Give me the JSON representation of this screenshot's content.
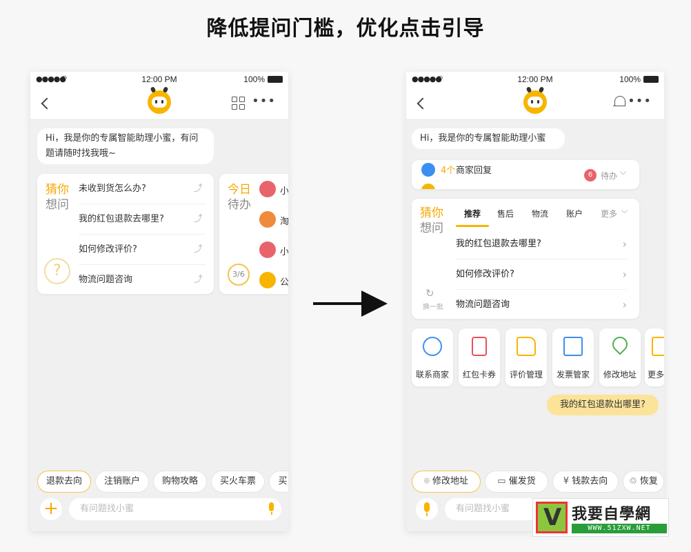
{
  "page": {
    "title": "降低提问门槛，优化点击引导"
  },
  "status": {
    "time": "12:00 PM",
    "battery": "100%"
  },
  "left": {
    "greeting": "Hi，我是你的专属智能助理小蜜，有问题请随时找我哦~",
    "guess": {
      "line1": "猜你",
      "line2": "想问"
    },
    "questions": [
      "未收到货怎么办?",
      "我的红包退款去哪里?",
      "如何修改评价?",
      "物流问题咨询"
    ],
    "todo": {
      "line1": "今日",
      "line2": "待办",
      "progress": "3/6",
      "items": [
        "小",
        "淘",
        "小",
        "公"
      ]
    },
    "chips": [
      "退款去向",
      "注销账户",
      "购物攻略",
      "买火车票",
      "买"
    ],
    "input_placeholder": "有问题找小蜜"
  },
  "right": {
    "greeting": "Hi，我是你的专属智能助理小蜜",
    "notice": {
      "text_prefix": "4个",
      "text": "商家回复",
      "badge": "6",
      "status": "待办"
    },
    "guess": {
      "line1": "猜你",
      "line2": "想问",
      "refresh": "换一批"
    },
    "tabs": [
      "推荐",
      "售后",
      "物流",
      "账户",
      "更多"
    ],
    "questions": [
      "我的红包退款去哪里?",
      "如何修改评价?",
      "物流问题咨询"
    ],
    "services": [
      {
        "label": "联系商家",
        "icon": "chat-bot-icon"
      },
      {
        "label": "红包卡券",
        "icon": "red-envelope-icon"
      },
      {
        "label": "评价管理",
        "icon": "thumbs-up-icon"
      },
      {
        "label": "发票管家",
        "icon": "invoice-icon"
      },
      {
        "label": "修改地址",
        "icon": "location-pin-icon"
      },
      {
        "label": "更多",
        "icon": "more-icon"
      }
    ],
    "user_message": "我的红包退款出哪里?",
    "chips": [
      "修改地址",
      "催发货",
      "钱款去向",
      "恢复"
    ],
    "input_placeholder": "有问题找小蜜"
  },
  "watermark": {
    "text": "我要自學網",
    "url": "WWW.51ZXW.NET"
  }
}
